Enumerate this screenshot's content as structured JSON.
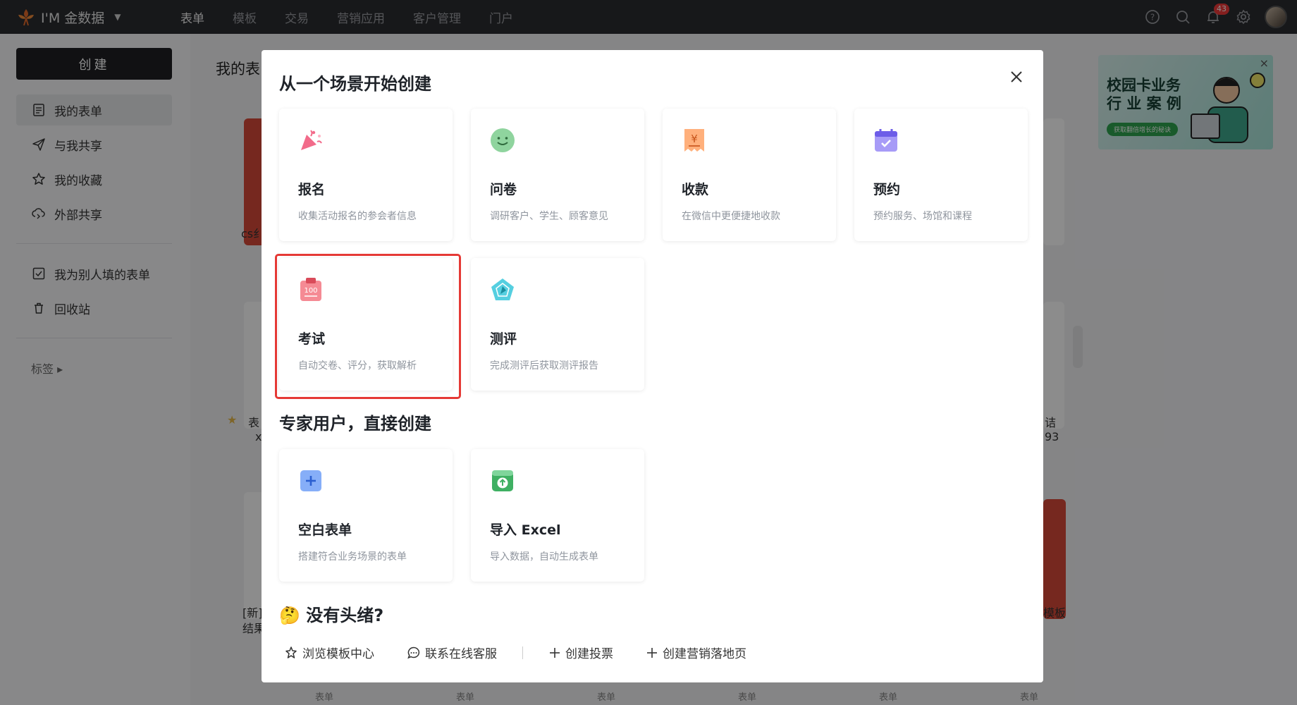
{
  "topbar": {
    "brand": "I'M 金数据",
    "nav": [
      "表单",
      "模板",
      "交易",
      "营销应用",
      "客户管理",
      "门户"
    ],
    "notification_count": "43",
    "icons": [
      "help-icon",
      "search-icon",
      "bell-icon",
      "gear-icon"
    ]
  },
  "sidebar": {
    "create_label": "创建",
    "items": [
      {
        "label": "我的表单",
        "icon": "form-icon"
      },
      {
        "label": "与我共享",
        "icon": "send-icon"
      },
      {
        "label": "我的收藏",
        "icon": "star-icon"
      },
      {
        "label": "外部共享",
        "icon": "cloud-share-icon"
      },
      {
        "label": "我为别人填的表单",
        "icon": "checkbox-icon"
      },
      {
        "label": "回收站",
        "icon": "trash-icon"
      }
    ],
    "tag_label": "标签 ▸"
  },
  "main": {
    "title": "我的表",
    "ad": {
      "title": "校园卡业务 行 业 案 例",
      "subtitle": "获取翻倍增长的秘诀"
    },
    "bottom_strip": [
      "表单",
      "表单",
      "表单",
      "表单",
      "表单",
      "表单"
    ],
    "peek_texts": {
      "cs": "cs纟",
      "star_text": "表",
      "x": "x",
      "new": "[新]",
      "result": "结果",
      "right_a": "诘",
      "right_b": "93",
      "right_c": "模板"
    }
  },
  "modal": {
    "title": "从一个场景开始创建",
    "scenes": [
      {
        "name": "报名",
        "desc": "收集活动报名的参会者信息",
        "icon": "party-popper-icon",
        "color": "#f06a8a"
      },
      {
        "name": "问卷",
        "desc": "调研客户、学生、顾客意见",
        "icon": "smile-face-icon",
        "color": "#7ecf8f"
      },
      {
        "name": "收款",
        "desc": "在微信中更便捷地收款",
        "icon": "yuan-receipt-icon",
        "color": "#ffa36b"
      },
      {
        "name": "预约",
        "desc": "预约服务、场馆和课程",
        "icon": "calendar-check-icon",
        "color": "#8a7ef5"
      },
      {
        "name": "考试",
        "desc": "自动交卷、评分，获取解析",
        "icon": "exam-score-icon",
        "color": "#f0707a"
      },
      {
        "name": "测评",
        "desc": "完成测评后获取测评报告",
        "icon": "radar-pentagon-icon",
        "color": "#45c7d8"
      }
    ],
    "expert_title": "专家用户，直接创建",
    "expert_items": [
      {
        "name": "空白表单",
        "desc": "搭建符合业务场景的表单",
        "icon": "plus-square-icon",
        "color": "#6d9cf6"
      },
      {
        "name": "导入 Excel",
        "desc": "导入数据，自动生成表单",
        "icon": "upload-excel-icon",
        "color": "#3dac5c"
      }
    ],
    "no_idea_emoji": "🤔",
    "no_idea_title": "没有头绪?",
    "helpers": [
      {
        "label": "浏览模板中心",
        "icon": "template-center-icon"
      },
      {
        "label": "联系在线客服",
        "icon": "chat-bubble-icon"
      },
      {
        "label": "创建投票",
        "icon": "plus-icon"
      },
      {
        "label": "创建营销落地页",
        "icon": "plus-icon"
      }
    ]
  }
}
